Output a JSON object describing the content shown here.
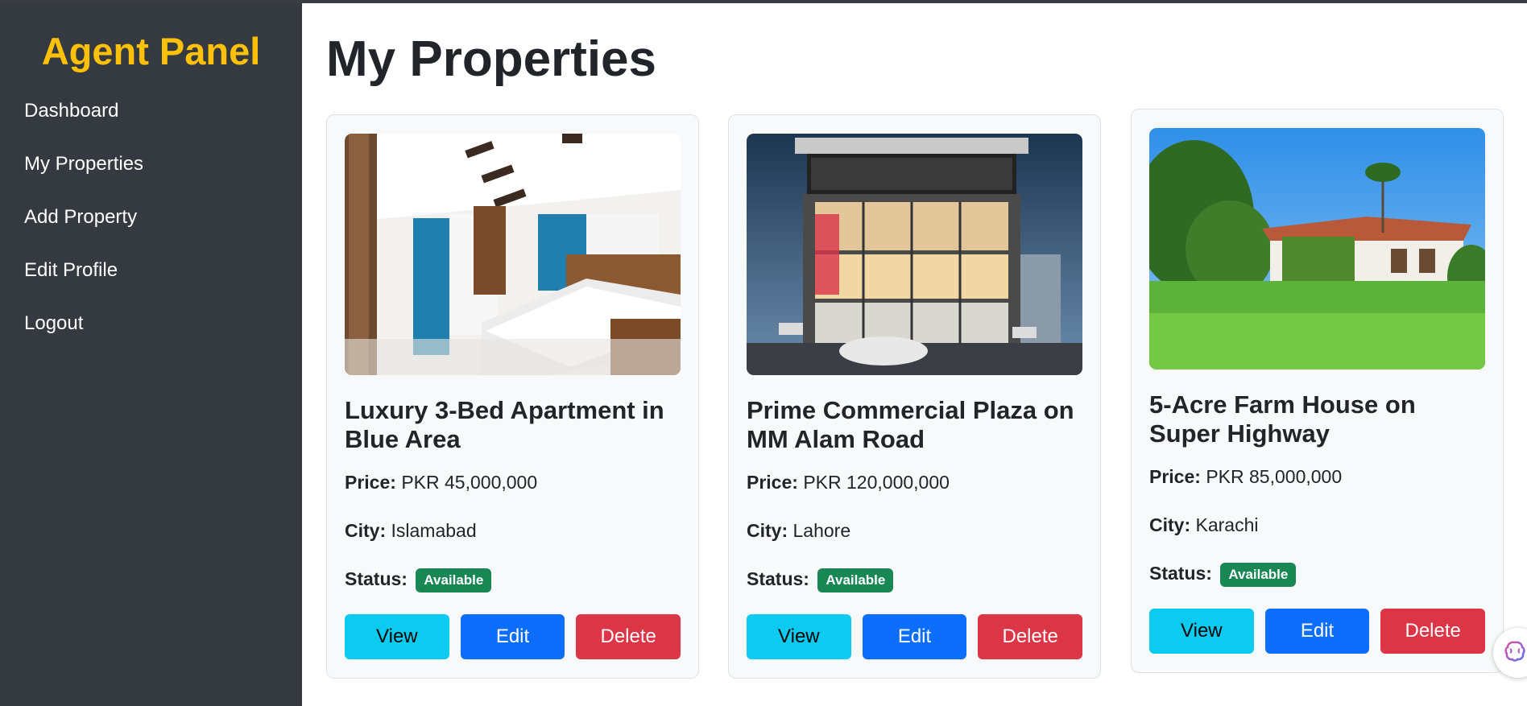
{
  "sidebar": {
    "brand": "Agent Panel",
    "items": [
      {
        "label": "Dashboard"
      },
      {
        "label": "My Properties"
      },
      {
        "label": "Add Property"
      },
      {
        "label": "Edit Profile"
      },
      {
        "label": "Logout"
      }
    ]
  },
  "main": {
    "title": "My Properties",
    "labels": {
      "price": "Price:",
      "city": "City:",
      "status": "Status:",
      "view": "View",
      "edit": "Edit",
      "delete": "Delete"
    },
    "properties": [
      {
        "title": "Luxury 3-Bed Apartment in Blue Area",
        "price": "PKR 45,000,000",
        "city": "Islamabad",
        "status": "Available",
        "image": "bedroom-photo"
      },
      {
        "title": "Prime Commercial Plaza on MM Alam Road",
        "price": "PKR 120,000,000",
        "city": "Lahore",
        "status": "Available",
        "image": "commercial-plaza-photo"
      },
      {
        "title": "5-Acre Farm House on Super Highway",
        "price": "PKR 85,000,000",
        "city": "Karachi",
        "status": "Available",
        "image": "farm-house-photo"
      }
    ]
  },
  "colors": {
    "sidebar_bg": "#343a40",
    "brand": "#ffc107",
    "badge": "#198754",
    "view": "#0dcaf0",
    "edit": "#0d6efd",
    "delete": "#dc3545"
  },
  "icons": [
    "assistant-brain-icon"
  ]
}
